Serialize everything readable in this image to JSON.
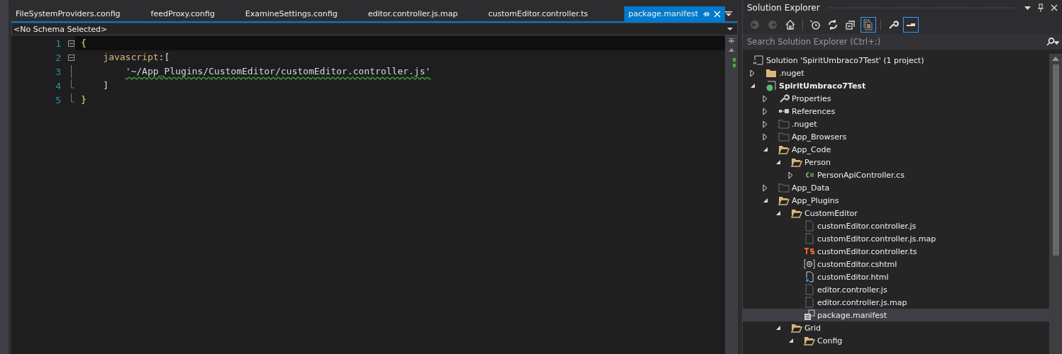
{
  "editor": {
    "tabs": [
      {
        "label": "FileSystemProviders.config",
        "selected": false
      },
      {
        "label": "feedProxy.config",
        "selected": false
      },
      {
        "label": "ExamineSettings.config",
        "selected": false
      },
      {
        "label": "editor.controller.js.map",
        "selected": false
      },
      {
        "label": "customEditor.controller.ts",
        "selected": false
      },
      {
        "label": "package.manifest",
        "selected": true
      }
    ],
    "schema": "<No Schema Selected>",
    "lines": [
      {
        "number": "1",
        "kind": "fold-start",
        "current": true,
        "tokens": [
          {
            "text": "{",
            "kind": "brace"
          }
        ]
      },
      {
        "number": "2",
        "kind": "fold-start",
        "current": false,
        "tokens": [
          {
            "text": "    javascript",
            "kind": "key"
          },
          {
            "text": ":[",
            "kind": "punct"
          }
        ]
      },
      {
        "number": "3",
        "kind": "fold-body",
        "current": false,
        "tokens": [
          {
            "text": "        '~/App_Plugins/CustomEditor/customEditor.controller.js'",
            "kind": "string",
            "squiggle": true
          }
        ]
      },
      {
        "number": "4",
        "kind": "fold-end",
        "current": false,
        "tokens": [
          {
            "text": "    ]",
            "kind": "punct"
          }
        ]
      },
      {
        "number": "5",
        "kind": "fold-end",
        "current": false,
        "tokens": [
          {
            "text": "}",
            "kind": "brace"
          }
        ]
      }
    ]
  },
  "solution_explorer": {
    "title": "Solution Explorer",
    "toolbar": [
      {
        "kind": "back",
        "active": false
      },
      {
        "kind": "forward",
        "active": false
      },
      {
        "kind": "home",
        "active": false
      },
      {
        "kind": "history",
        "active": false
      },
      {
        "kind": "sync",
        "active": false
      },
      {
        "kind": "collapse",
        "active": false
      },
      {
        "kind": "show-all",
        "active": true
      },
      {
        "kind": "properties",
        "active": false
      },
      {
        "kind": "preview",
        "active": true
      }
    ],
    "search": {
      "placeholder": "Search Solution Explorer (Ctrl+;)"
    },
    "tree": [
      {
        "label": "Solution 'SpiritUmbraco7Test' (1 project)",
        "kind": "solution",
        "selected": false,
        "children": [
          {
            "label": ".nuget",
            "kind": "folder",
            "expanded": false,
            "selected": false
          },
          {
            "label": "SpiritUmbraco7Test",
            "kind": "project",
            "bold": true,
            "expanded": true,
            "selected": false,
            "children": [
              {
                "label": "Properties",
                "kind": "wrench",
                "expanded": false,
                "selected": false
              },
              {
                "label": "References",
                "kind": "references",
                "expanded": false,
                "selected": false
              },
              {
                "label": ".nuget",
                "kind": "excluded",
                "expanded": false,
                "selected": false
              },
              {
                "label": "App_Browsers",
                "kind": "excluded",
                "expanded": false,
                "selected": false
              },
              {
                "label": "App_Code",
                "kind": "open-folder",
                "expanded": true,
                "selected": false,
                "children": [
                  {
                    "label": "Person",
                    "kind": "open-folder",
                    "expanded": true,
                    "selected": false,
                    "children": [
                      {
                        "label": "PersonApiController.cs",
                        "kind": "csharp",
                        "expanded": false,
                        "selected": false
                      }
                    ]
                  }
                ]
              },
              {
                "label": "App_Data",
                "kind": "excluded",
                "expanded": false,
                "selected": false
              },
              {
                "label": "App_Plugins",
                "kind": "open-folder",
                "expanded": true,
                "selected": false,
                "children": [
                  {
                    "label": "CustomEditor",
                    "kind": "open-folder",
                    "expanded": true,
                    "selected": false,
                    "children": [
                      {
                        "label": "customEditor.controller.js",
                        "kind": "file",
                        "selected": false
                      },
                      {
                        "label": "customEditor.controller.js.map",
                        "kind": "file",
                        "selected": false
                      },
                      {
                        "label": "customEditor.controller.ts",
                        "kind": "typescript",
                        "selected": false
                      },
                      {
                        "label": "customEditor.cshtml",
                        "kind": "razor",
                        "selected": false
                      },
                      {
                        "label": "customEditor.html",
                        "kind": "html",
                        "selected": false
                      },
                      {
                        "label": "editor.controller.js",
                        "kind": "file",
                        "selected": false
                      },
                      {
                        "label": "editor.controller.js.map",
                        "kind": "file",
                        "selected": false
                      },
                      {
                        "label": "package.manifest",
                        "kind": "manifest",
                        "selected": true
                      }
                    ]
                  },
                  {
                    "label": "Grid",
                    "kind": "open-folder",
                    "expanded": true,
                    "selected": false,
                    "children": [
                      {
                        "label": "Config",
                        "kind": "open-folder",
                        "expanded": true,
                        "selected": false
                      }
                    ]
                  }
                ]
              }
            ]
          }
        ]
      }
    ]
  }
}
